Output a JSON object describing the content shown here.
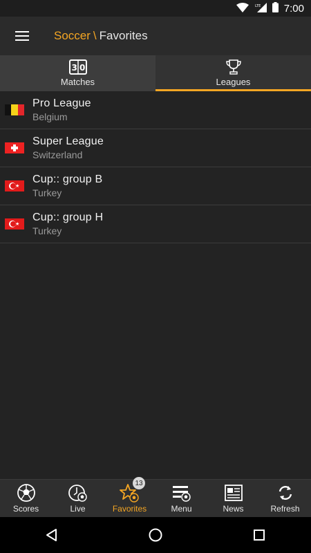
{
  "status_bar": {
    "time": "7:00",
    "network": "LTE"
  },
  "app_bar": {
    "sport": "Soccer",
    "separator": "\\",
    "section": "Favorites"
  },
  "tabs": [
    {
      "label": "Matches",
      "icon": "scoreboard-icon",
      "icon_text": "30",
      "active": false
    },
    {
      "label": "Leagues",
      "icon": "trophy-icon",
      "active": true
    }
  ],
  "leagues": [
    {
      "name": "Pro League",
      "country": "Belgium",
      "flag": "belgium-flag-icon"
    },
    {
      "name": "Super League",
      "country": "Switzerland",
      "flag": "switzerland-flag-icon"
    },
    {
      "name": "Cup:: group B",
      "country": "Turkey",
      "flag": "turkey-flag-icon"
    },
    {
      "name": "Cup:: group H",
      "country": "Turkey",
      "flag": "turkey-flag-icon"
    }
  ],
  "bottom_nav": {
    "scores": "Scores",
    "live": "Live",
    "favorites": "Favorites",
    "favorites_badge": "13",
    "menu": "Menu",
    "news": "News",
    "refresh": "Refresh"
  },
  "colors": {
    "accent": "#f5a623",
    "background": "#232323",
    "appbar": "#2b2b2b"
  }
}
